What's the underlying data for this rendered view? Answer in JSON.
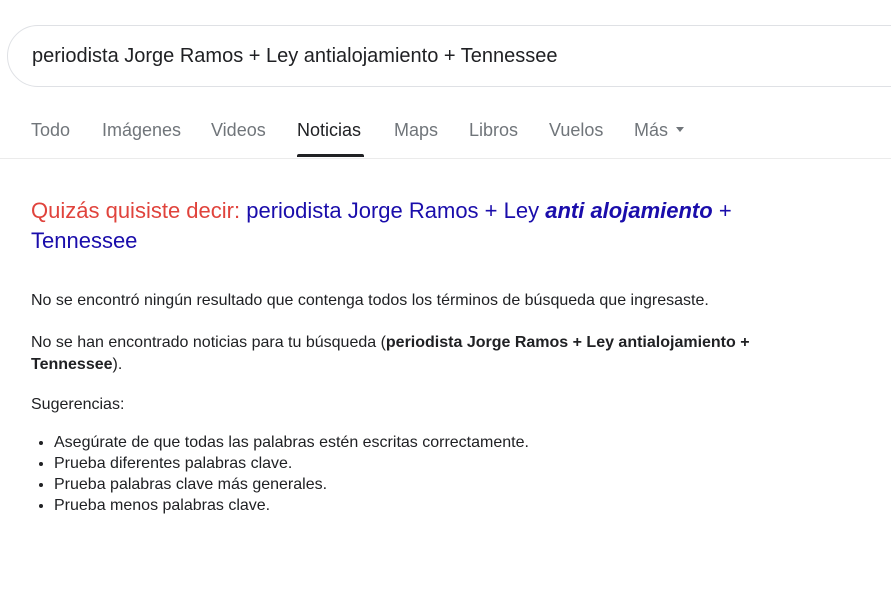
{
  "search": {
    "query": "periodista Jorge Ramos + Ley antialojamiento + Tennessee"
  },
  "tabs": [
    {
      "label": "Todo"
    },
    {
      "label": "Imágenes"
    },
    {
      "label": "Videos"
    },
    {
      "label": "Noticias"
    },
    {
      "label": "Maps"
    },
    {
      "label": "Libros"
    },
    {
      "label": "Vuelos"
    },
    {
      "label": "Más"
    }
  ],
  "active_tab": "Noticias",
  "did_you_mean": {
    "label": "Quizás quisiste decir:",
    "link_before": "periodista Jorge Ramos + Ley ",
    "link_bold": "anti alojamiento",
    "link_after": " + Tennessee"
  },
  "messages": {
    "no_results_all_terms": "No se encontró ningún resultado que contenga todos los términos de búsqueda que ingresaste.",
    "no_news_prefix": "No se han encontrado noticias para tu búsqueda (",
    "no_news_query": "periodista Jorge Ramos + Ley antialojamiento + Tennessee",
    "no_news_suffix": ").",
    "suggestions_heading": "Sugerencias:"
  },
  "suggestions": [
    "Asegúrate de que todas las palabras estén escritas correctamente.",
    "Prueba diferentes palabras clave.",
    "Prueba palabras clave más generales.",
    "Prueba menos palabras clave."
  ]
}
